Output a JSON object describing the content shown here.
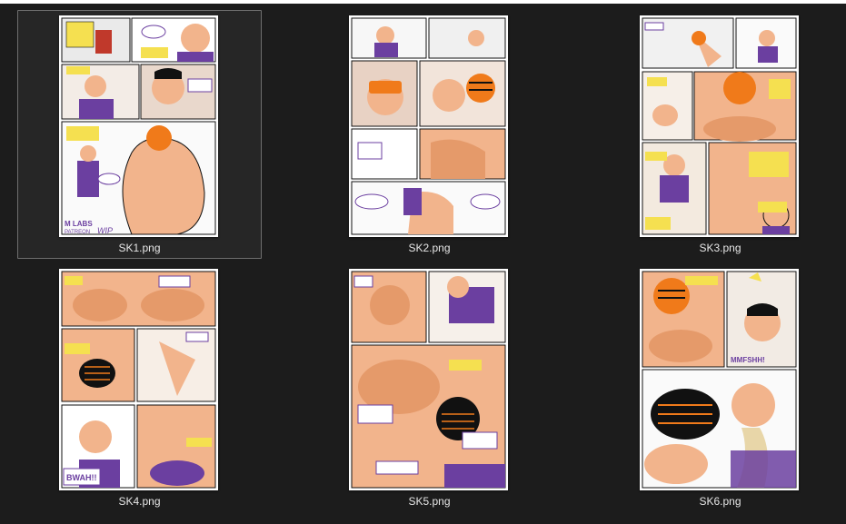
{
  "colors": {
    "background": "#1c1c1c",
    "selection_border": "#6e6e6e",
    "caption_text": "#e6e6e6",
    "skin": "#f2b48c",
    "purple": "#6b3fa0",
    "orange": "#f07a1a",
    "bubble_yellow": "#f5e050",
    "ink": "#111111"
  },
  "files": [
    {
      "name": "SK1.png",
      "selected": true,
      "page_text": {
        "lettering": "M LABS",
        "patreon": "PATREON",
        "wip": "WIP"
      }
    },
    {
      "name": "SK2.png",
      "selected": false
    },
    {
      "name": "SK3.png",
      "selected": false
    },
    {
      "name": "SK4.png",
      "selected": false,
      "page_text": {
        "sfx": "BWAH!!"
      }
    },
    {
      "name": "SK5.png",
      "selected": false
    },
    {
      "name": "SK6.png",
      "selected": false,
      "page_text": {
        "sfx": "MMFSHH!"
      }
    }
  ]
}
